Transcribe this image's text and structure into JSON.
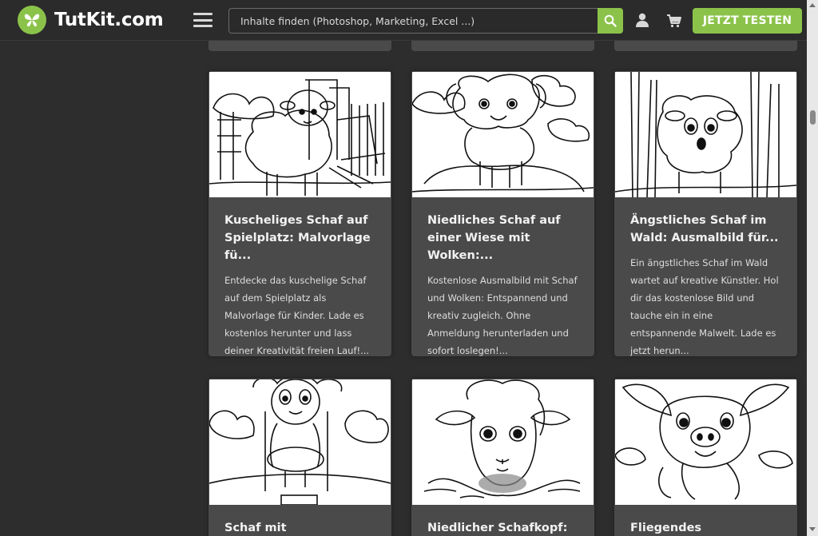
{
  "header": {
    "logo_text": "TutKit.com",
    "search_placeholder": "Inhalte finden (Photoshop, Marketing, Excel ...)",
    "cta_label": "JETZT TESTEN"
  },
  "colors": {
    "accent": "#8bc34a",
    "background": "#2d2d2d",
    "card": "#4a4a4a"
  },
  "icons": [
    "butterfly-logo-icon",
    "hamburger-menu-icon",
    "search-icon",
    "user-icon",
    "cart-icon"
  ],
  "cards": [
    {
      "title": "Kuscheliges Schaf auf Spielplatz: Malvorlage fü...",
      "desc": "Entdecke das kuschelige Schaf auf dem Spielplatz als Malvorlage für Kinder. Lade es kostenlos herunter und lass deiner Kreativität freien Lauf!..."
    },
    {
      "title": "Niedliches Schaf auf einer Wiese mit Wolken:...",
      "desc": "Kostenlose Ausmalbild mit Schaf und Wolken: Entspannend und kreativ zugleich. Ohne Anmeldung herunterladen und sofort loslegen!..."
    },
    {
      "title": "Ängstliches Schaf im Wald: Ausmalbild für...",
      "desc": "Ein ängstliches Schaf im Wald wartet auf kreative Künstler. Hol dir das kostenlose Bild und tauche ein in eine entspannende Malwelt. Lade es jetzt herun..."
    },
    {
      "title": "Schaf mit Schwimmring",
      "desc": ""
    },
    {
      "title": "Niedlicher Schafkopf:",
      "desc": ""
    },
    {
      "title": "Fliegendes Schweinchen",
      "desc": ""
    }
  ]
}
